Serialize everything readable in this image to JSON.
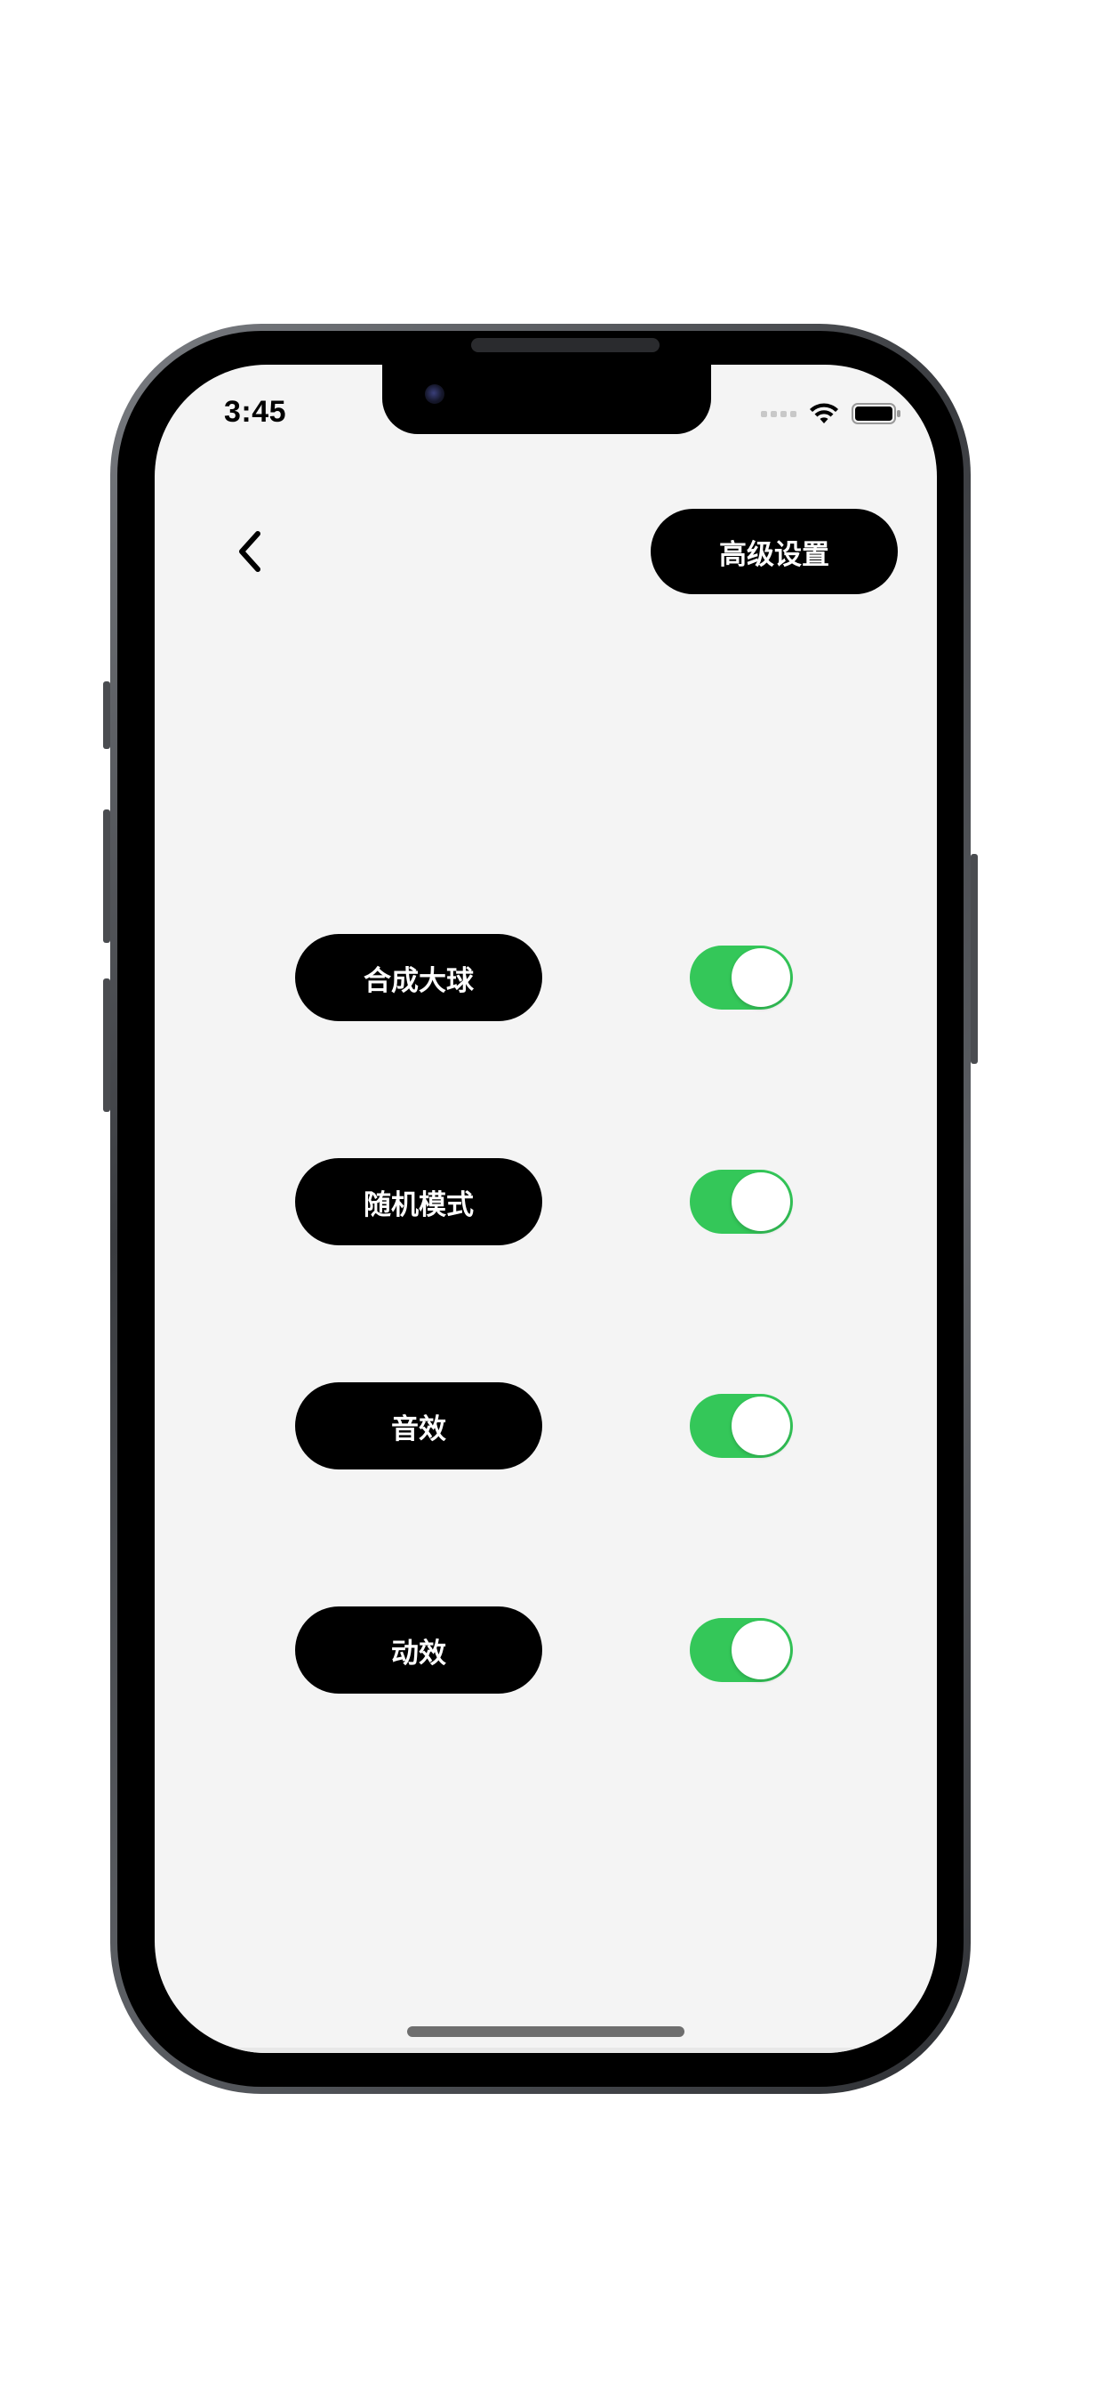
{
  "status_bar": {
    "time": "3:45"
  },
  "header": {
    "back_icon": "chevron-left-icon",
    "advanced_button_label": "高级设置"
  },
  "settings": [
    {
      "label": "合成大球",
      "enabled": true
    },
    {
      "label": "随机模式",
      "enabled": true
    },
    {
      "label": "音效",
      "enabled": true
    },
    {
      "label": "动效",
      "enabled": true
    }
  ],
  "colors": {
    "background": "#f4f4f4",
    "pill": "#000000",
    "pill_text": "#ffffff",
    "toggle_on": "#34c759"
  }
}
